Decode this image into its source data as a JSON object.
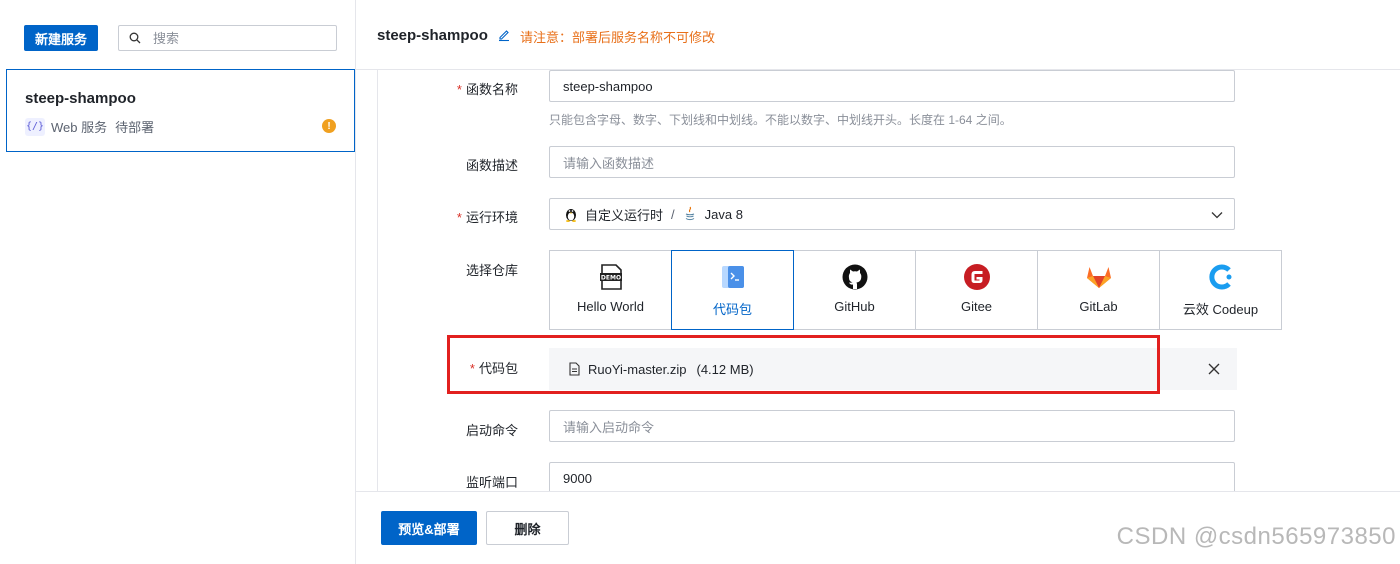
{
  "sidebar": {
    "new_button": "新建服务",
    "search_placeholder": "搜索",
    "service": {
      "name": "steep-shampoo",
      "type": "Web 服务",
      "status": "待部署"
    }
  },
  "header": {
    "title": "steep-shampoo",
    "note": "请注意：部署后服务名称不可修改"
  },
  "form": {
    "name": {
      "label": "函数名称",
      "value": "steep-shampoo",
      "help": "只能包含字母、数字、下划线和中划线。不能以数字、中划线开头。长度在 1-64 之间。"
    },
    "desc": {
      "label": "函数描述",
      "placeholder": "请输入函数描述"
    },
    "runtime": {
      "label": "运行环境",
      "custom": "自定义运行时",
      "separator": "/",
      "lang": "Java 8"
    },
    "repo": {
      "label": "选择仓库",
      "options": [
        {
          "label": "Hello World",
          "icon": "demo-icon"
        },
        {
          "label": "代码包",
          "icon": "code-package-icon",
          "active": true
        },
        {
          "label": "GitHub",
          "icon": "github-icon"
        },
        {
          "label": "Gitee",
          "icon": "gitee-icon"
        },
        {
          "label": "GitLab",
          "icon": "gitlab-icon"
        },
        {
          "label": "云效 Codeup",
          "icon": "codeup-icon"
        }
      ]
    },
    "package": {
      "label": "代码包",
      "file": "RuoYi-master.zip",
      "size": "(4.12 MB)"
    },
    "start_cmd": {
      "label": "启动命令",
      "placeholder": "请输入启动命令"
    },
    "port": {
      "label": "监听端口",
      "value": "9000"
    }
  },
  "footer": {
    "deploy_button": "预览&部署",
    "delete_button": "删除"
  },
  "watermark": "CSDN @csdn565973850",
  "colors": {
    "primary": "#0064c8",
    "warning": "#e8701a",
    "highlight": "#e2201f",
    "required": "#d93026"
  }
}
